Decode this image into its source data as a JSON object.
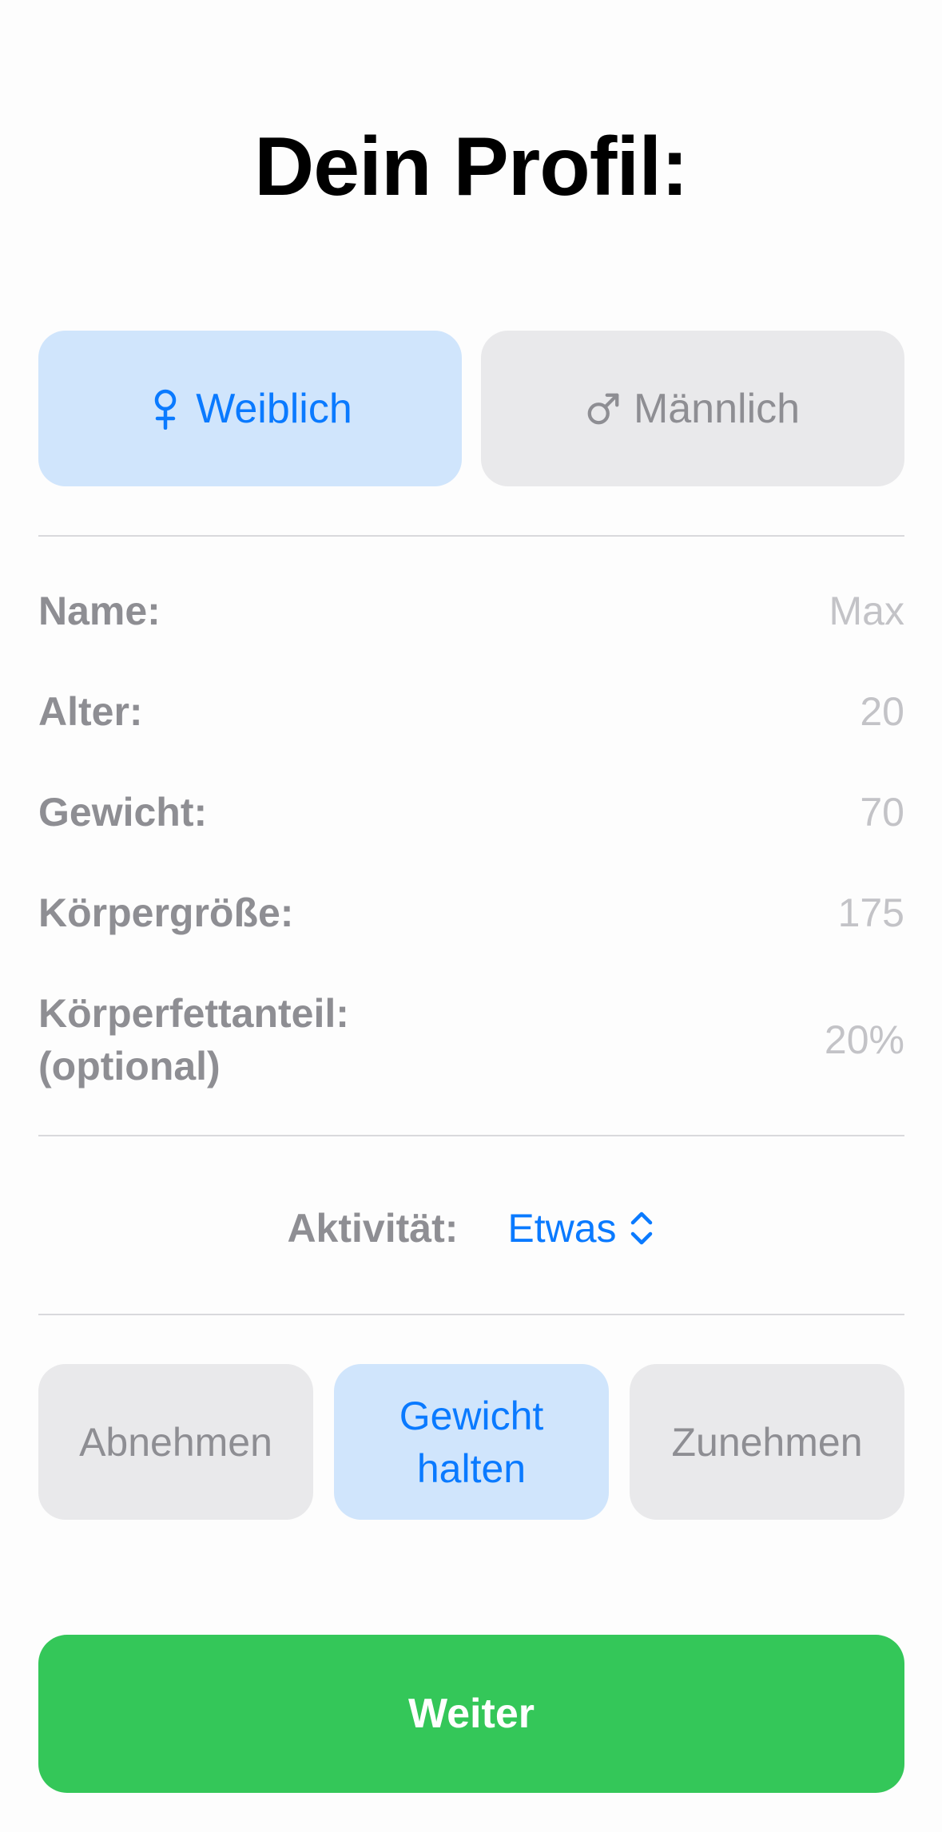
{
  "title": "Dein Profil:",
  "gender": {
    "female_label": "Weiblich",
    "male_label": "Männlich",
    "selected": "Weiblich"
  },
  "fields": {
    "name": {
      "label": "Name:",
      "placeholder": "Max"
    },
    "age": {
      "label": "Alter:",
      "placeholder": "20"
    },
    "weight": {
      "label": "Gewicht:",
      "placeholder": "70"
    },
    "height": {
      "label": "Körpergröße:",
      "placeholder": "175"
    },
    "bodyfat": {
      "label_line1": "Körperfettanteil:",
      "label_line2": "(optional)",
      "placeholder": "20%"
    }
  },
  "activity": {
    "label": "Aktivität:",
    "selected": "Etwas"
  },
  "goals": {
    "lose": "Abnehmen",
    "keep_line1": "Gewicht",
    "keep_line2": "halten",
    "gain": "Zunehmen",
    "selected": "Gewicht halten"
  },
  "next_button": "Weiter",
  "colors": {
    "accent": "#0a7aff",
    "selected_bg": "#d0e5fc",
    "unselected_bg": "#e9e9eb",
    "primary_button": "#34c759"
  },
  "icons": {
    "female": "female-symbol-icon",
    "male": "male-symbol-icon",
    "picker": "chevron-up-down-icon"
  }
}
